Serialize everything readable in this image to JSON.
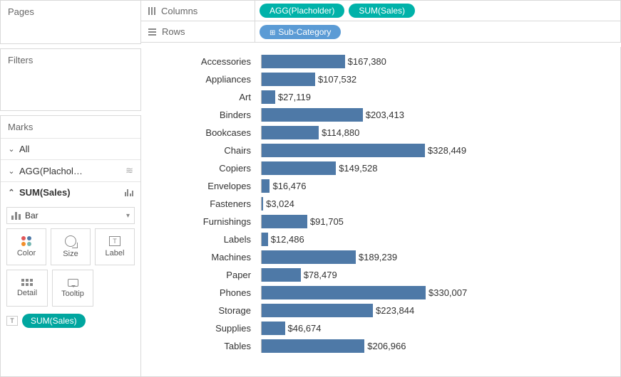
{
  "sidebar": {
    "pages_label": "Pages",
    "filters_label": "Filters",
    "marks_label": "Marks",
    "all_label": "All",
    "agg_label": "AGG(Plachol…",
    "sum_label": "SUM(Sales)",
    "mark_type": "Bar",
    "btn_color": "Color",
    "btn_size": "Size",
    "btn_label": "Label",
    "btn_detail": "Detail",
    "btn_tooltip": "Tooltip",
    "label_pill": "SUM(Sales)"
  },
  "shelves": {
    "columns_label": "Columns",
    "rows_label": "Rows",
    "col_pill_1": "AGG(Placholder)",
    "col_pill_2": "SUM(Sales)",
    "row_pill_1": "Sub-Category"
  },
  "chart_data": {
    "type": "bar",
    "xlabel": "",
    "ylabel": "",
    "max": 330007,
    "color": "#4e79a7",
    "rows": [
      {
        "category": "Accessories",
        "value": 167380,
        "label": "$167,380"
      },
      {
        "category": "Appliances",
        "value": 107532,
        "label": "$107,532"
      },
      {
        "category": "Art",
        "value": 27119,
        "label": "$27,119"
      },
      {
        "category": "Binders",
        "value": 203413,
        "label": "$203,413"
      },
      {
        "category": "Bookcases",
        "value": 114880,
        "label": "$114,880"
      },
      {
        "category": "Chairs",
        "value": 328449,
        "label": "$328,449"
      },
      {
        "category": "Copiers",
        "value": 149528,
        "label": "$149,528"
      },
      {
        "category": "Envelopes",
        "value": 16476,
        "label": "$16,476"
      },
      {
        "category": "Fasteners",
        "value": 3024,
        "label": "$3,024"
      },
      {
        "category": "Furnishings",
        "value": 91705,
        "label": "$91,705"
      },
      {
        "category": "Labels",
        "value": 12486,
        "label": "$12,486"
      },
      {
        "category": "Machines",
        "value": 189239,
        "label": "$189,239"
      },
      {
        "category": "Paper",
        "value": 78479,
        "label": "$78,479"
      },
      {
        "category": "Phones",
        "value": 330007,
        "label": "$330,007"
      },
      {
        "category": "Storage",
        "value": 223844,
        "label": "$223,844"
      },
      {
        "category": "Supplies",
        "value": 46674,
        "label": "$46,674"
      },
      {
        "category": "Tables",
        "value": 206966,
        "label": "$206,966"
      }
    ]
  }
}
